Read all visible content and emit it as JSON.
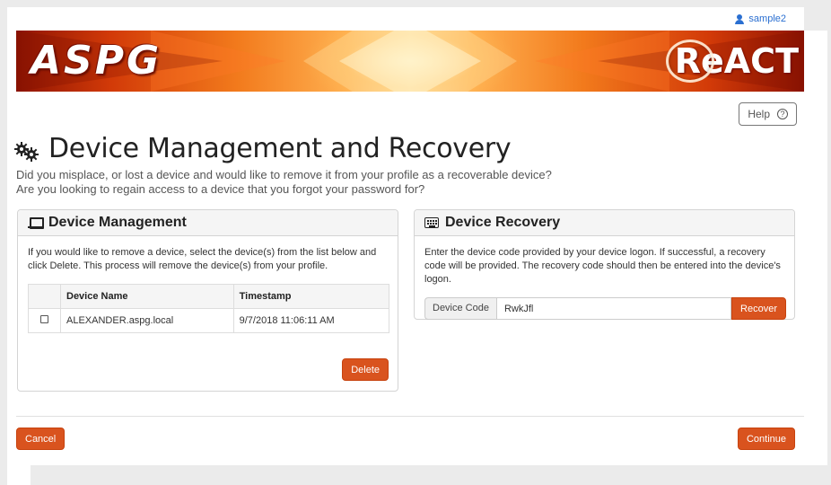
{
  "topbar": {
    "username": "sample2"
  },
  "banner": {
    "left_logo": "ASPG",
    "right_logo": "ReACT"
  },
  "help": {
    "label": "Help"
  },
  "page": {
    "title": "Device Management and Recovery",
    "subtitle_line1": "Did you misplace, or lost a device and would like to remove it from your profile as a recoverable device?",
    "subtitle_line2": "Are you looking to regain access to a device that you forgot your password for?"
  },
  "device_management": {
    "title": "Device Management",
    "description": "If you would like to remove a device, select the device(s) from the list below and click Delete. This process will remove the device(s) from your profile.",
    "columns": [
      "",
      "Device Name",
      "Timestamp"
    ],
    "rows": [
      {
        "checked": false,
        "device_name": "ALEXANDER.aspg.local",
        "timestamp": "9/7/2018 11:06:11 AM"
      }
    ],
    "delete_label": "Delete"
  },
  "device_recovery": {
    "title": "Device Recovery",
    "description": "Enter the device code provided by your device logon. If successful, a recovery code will be provided. The recovery code should then be entered into the device's logon.",
    "field_label": "Device Code",
    "field_value": "RwkJfl",
    "recover_label": "Recover"
  },
  "footer": {
    "cancel_label": "Cancel",
    "continue_label": "Continue"
  },
  "colors": {
    "accent": "#d9531e",
    "link": "#2a6fd1"
  }
}
